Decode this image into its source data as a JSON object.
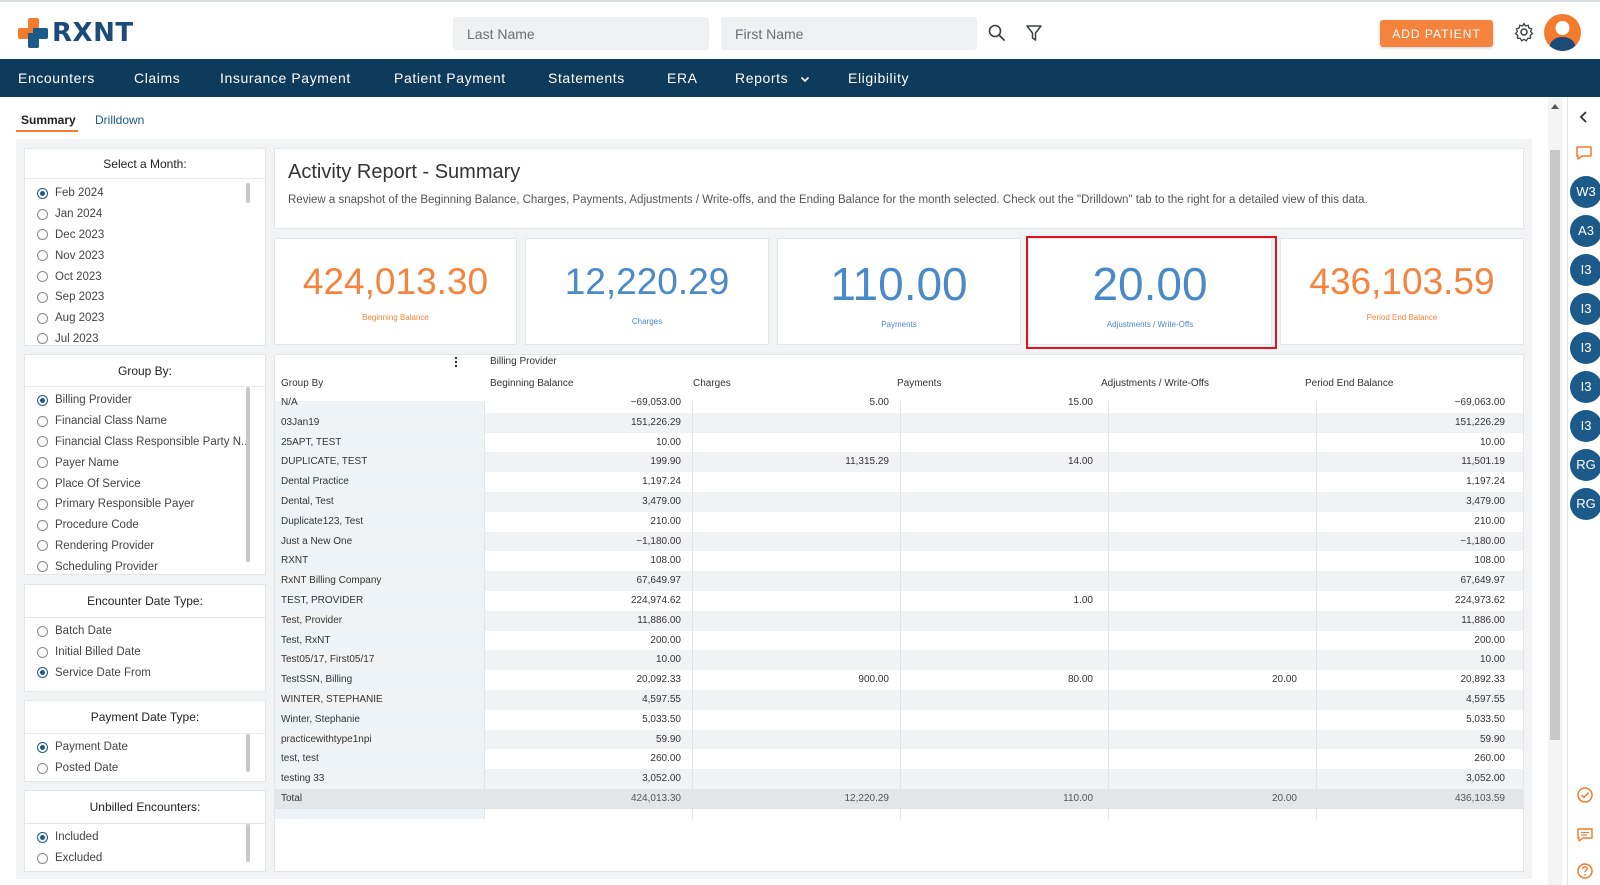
{
  "app": {
    "logo_text": "RXNT",
    "search": {
      "last_name_placeholder": "Last Name",
      "first_name_placeholder": "First Name"
    },
    "add_patient_label": "ADD PATIENT",
    "accent": "#f4843d",
    "brand": "#0e3a5c"
  },
  "nav": {
    "items": [
      "Encounters",
      "Claims",
      "Insurance Payment",
      "Patient Payment",
      "Statements",
      "ERA",
      "Reports",
      "Eligibility"
    ]
  },
  "subtabs": [
    "Summary",
    "Drilldown"
  ],
  "filters": {
    "month": {
      "title": "Select a Month:",
      "options": [
        "Feb 2024",
        "Jan 2024",
        "Dec 2023",
        "Nov 2023",
        "Oct 2023",
        "Sep 2023",
        "Aug 2023",
        "Jul 2023"
      ],
      "selected_index": 0
    },
    "group_by": {
      "title": "Group By:",
      "options": [
        "Billing Provider",
        "Financial Class Name",
        "Financial Class Responsible Party N...",
        "Payer Name",
        "Place Of Service",
        "Primary Responsible Payer",
        "Procedure Code",
        "Rendering Provider",
        "Scheduling Provider"
      ],
      "selected_index": 0
    },
    "encounter_date_type": {
      "title": "Encounter Date Type:",
      "options": [
        "Batch Date",
        "Initial Billed Date",
        "Service Date From"
      ],
      "selected_index": 2
    },
    "payment_date_type": {
      "title": "Payment Date Type:",
      "options": [
        "Payment Date",
        "Posted Date"
      ],
      "selected_index": 0
    },
    "unbilled_encounters": {
      "title": "Unbilled Encounters:",
      "options": [
        "Included",
        "Excluded"
      ],
      "selected_index": 0
    }
  },
  "report": {
    "title": "Activity Report - Summary",
    "description": "Review a snapshot of the Beginning Balance, Charges, Payments, Adjustments / Write-offs, and the Ending Balance for the month selected. Check out the \"Drilldown\" tab to the right for a detailed view of this data."
  },
  "kpis": [
    {
      "value": "424,013.30",
      "label": "Beginning Balance",
      "color": "#f4843d"
    },
    {
      "value": "12,220.29",
      "label": "Charges",
      "color": "#4a8ac9"
    },
    {
      "value": "110.00",
      "label": "Payments",
      "color": "#4a8ac9"
    },
    {
      "value": "20.00",
      "label": "Adjustments / Write-Offs",
      "color": "#4a8ac9"
    },
    {
      "value": "436,103.59",
      "label": "Period End Balance",
      "color": "#f4843d"
    }
  ],
  "table": {
    "group_header": "Billing Provider",
    "columns": [
      "Group By",
      "Beginning Balance",
      "Charges",
      "Payments",
      "Adjustments / Write-Offs",
      "Period End Balance"
    ],
    "rows": [
      [
        "N/A",
        "−69,053.00",
        "5.00",
        "15.00",
        "",
        "−69,063.00"
      ],
      [
        "03Jan19",
        "151,226.29",
        "",
        "",
        "",
        "151,226.29"
      ],
      [
        "25APT, TEST",
        "10.00",
        "",
        "",
        "",
        "10.00"
      ],
      [
        "DUPLICATE, TEST",
        "199.90",
        "11,315.29",
        "14.00",
        "",
        "11,501.19"
      ],
      [
        "Dental Practice",
        "1,197.24",
        "",
        "",
        "",
        "1,197.24"
      ],
      [
        "Dental, Test",
        "3,479.00",
        "",
        "",
        "",
        "3,479.00"
      ],
      [
        "Duplicate123, Test",
        "210.00",
        "",
        "",
        "",
        "210.00"
      ],
      [
        "Just a New One",
        "−1,180.00",
        "",
        "",
        "",
        "−1,180.00"
      ],
      [
        "RXNT",
        "108.00",
        "",
        "",
        "",
        "108.00"
      ],
      [
        "RxNT Billing Company",
        "67,649.97",
        "",
        "",
        "",
        "67,649.97"
      ],
      [
        "TEST, PROVIDER",
        "224,974.62",
        "",
        "1.00",
        "",
        "224,973.62"
      ],
      [
        "Test, Provider",
        "11,886.00",
        "",
        "",
        "",
        "11,886.00"
      ],
      [
        "Test, RxNT",
        "200.00",
        "",
        "",
        "",
        "200.00"
      ],
      [
        "Test05/17, First05/17",
        "10.00",
        "",
        "",
        "",
        "10.00"
      ],
      [
        "TestSSN, Billing",
        "20,092.33",
        "900.00",
        "80.00",
        "20.00",
        "20,892.33"
      ],
      [
        "WINTER, STEPHANIE",
        "4,597.55",
        "",
        "",
        "",
        "4,597.55"
      ],
      [
        "Winter, Stephanie",
        "5,033.50",
        "",
        "",
        "",
        "5,033.50"
      ],
      [
        "practicewithtype1npi",
        "59.90",
        "",
        "",
        "",
        "59.90"
      ],
      [
        "test, test",
        "260.00",
        "",
        "",
        "",
        "260.00"
      ],
      [
        "testing 33",
        "3,052.00",
        "",
        "",
        "",
        "3,052.00"
      ],
      [
        "Total",
        "424,013.30",
        "12,220.29",
        "110.00",
        "20.00",
        "436,103.59"
      ]
    ]
  },
  "rail": {
    "badges": [
      "W3",
      "A3",
      "I3",
      "I3",
      "I3",
      "I3",
      "I3",
      "RG",
      "RG"
    ]
  }
}
